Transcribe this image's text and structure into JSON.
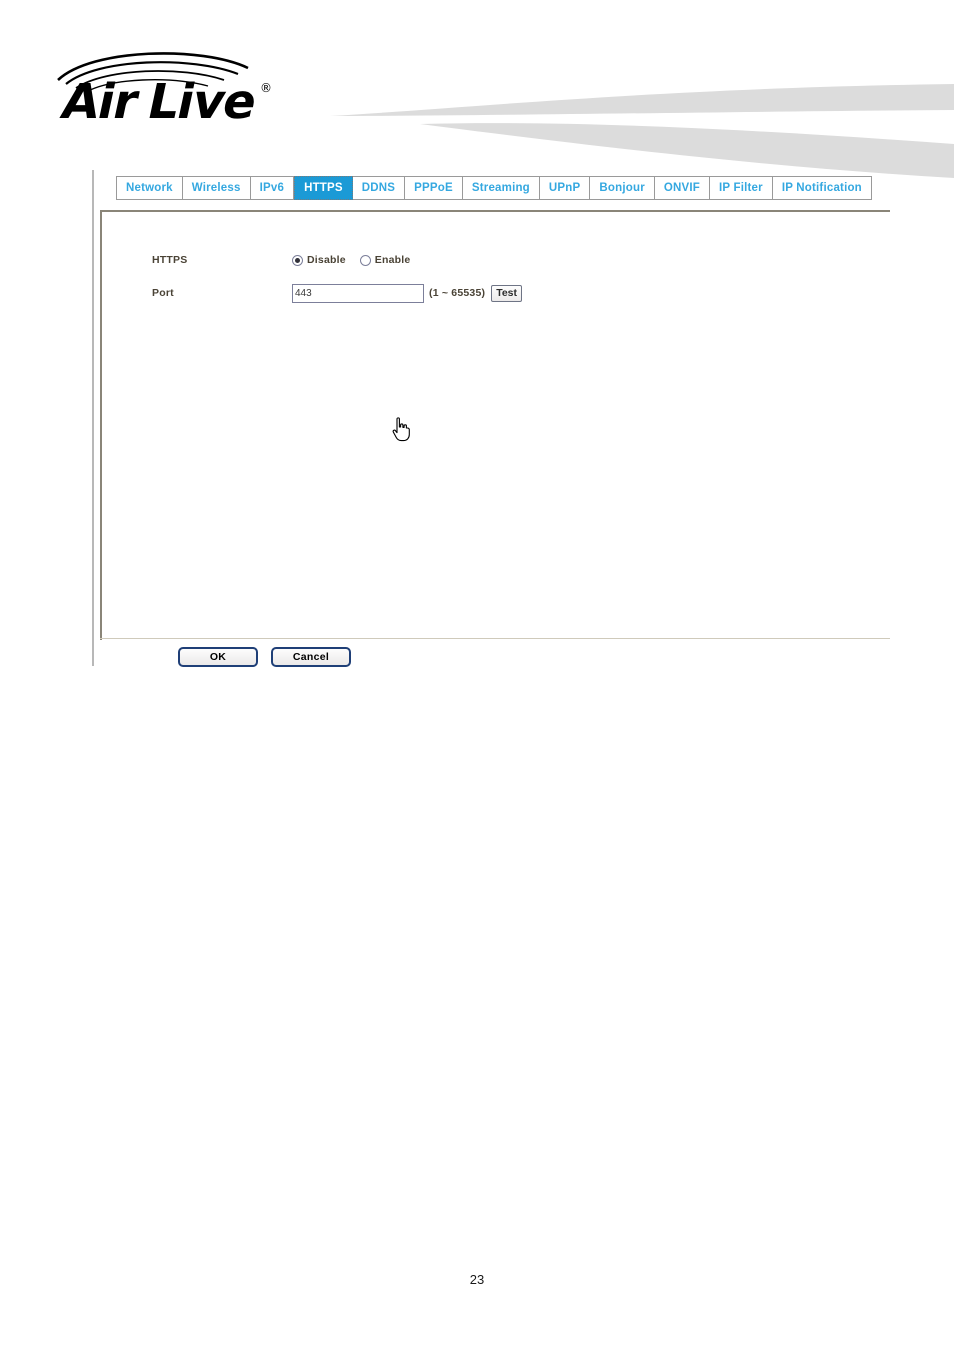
{
  "header": {
    "brand_name": "AirLive",
    "brand_trademark": "®",
    "logo_icon": "airlive-wireless-logo",
    "swoosh_icon": "decorative-swoosh-graphic",
    "swoosh_color": "#dcdcdc"
  },
  "tabs": {
    "active": "HTTPS",
    "active_bg": "#1b9ad6",
    "inactive_text_color": "#35a8e0",
    "items": [
      {
        "label": "Network"
      },
      {
        "label": "Wireless"
      },
      {
        "label": "IPv6"
      },
      {
        "label": "HTTPS"
      },
      {
        "label": "DDNS"
      },
      {
        "label": "PPPoE"
      },
      {
        "label": "Streaming"
      },
      {
        "label": "UPnP"
      },
      {
        "label": "Bonjour"
      },
      {
        "label": "ONVIF"
      },
      {
        "label": "IP Filter"
      },
      {
        "label": "IP Notification"
      }
    ]
  },
  "form": {
    "https": {
      "label": "HTTPS",
      "options": [
        {
          "label": "Disable",
          "selected": true
        },
        {
          "label": "Enable",
          "selected": false
        }
      ]
    },
    "port": {
      "label": "Port",
      "value": "443",
      "placeholder": "",
      "range_hint": "(1 ~ 65535)",
      "test_label": "Test"
    }
  },
  "footer": {
    "ok_label": "OK",
    "cancel_label": "Cancel"
  },
  "page": {
    "number": "23"
  },
  "cursor": {
    "icon": "hand-pointer-cursor"
  }
}
